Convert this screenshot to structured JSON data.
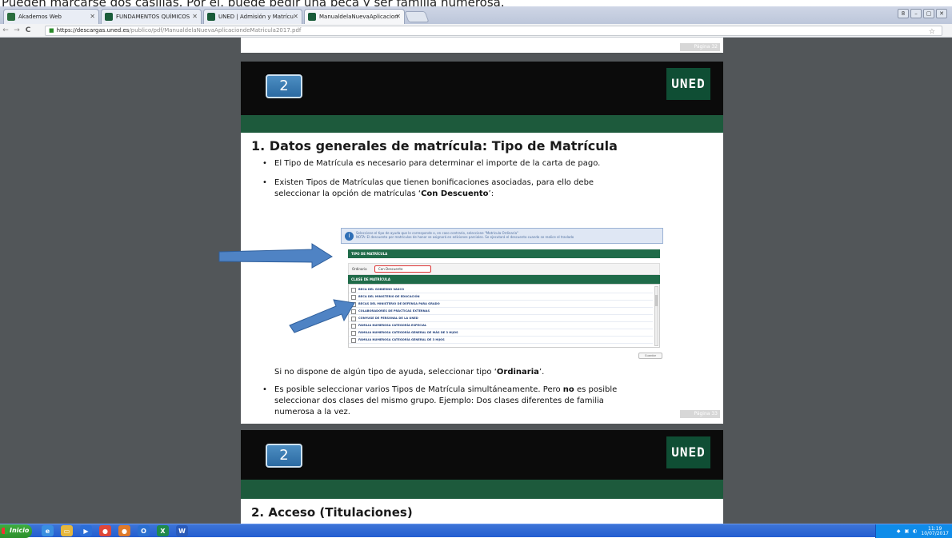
{
  "caption": {
    "text": "Pueden marcarse dos casillas. Por ej. puede pedir una beca y ser familia numerosa."
  },
  "browser": {
    "tabs": [
      {
        "title": "Akademos Web",
        "favicon_color": "#2b6e3f"
      },
      {
        "title": "FUNDAMENTOS QUÍMICOS",
        "favicon_color": "#1a5c3a"
      },
      {
        "title": "UNED | Admisión y Matrícu",
        "favicon_color": "#1a5c3a"
      },
      {
        "title": "ManualdelaNuevaAplicacion",
        "favicon_color": "#1a5c3a"
      }
    ],
    "active_tab": 3,
    "url_host": "https://descargas.uned.es",
    "url_path": "/publico/pdf/ManualdelaNuevaAplicaciondeMatricula2017.pdf",
    "nav": {
      "back": "←",
      "forward": "→",
      "reload": "C"
    },
    "window_buttons": [
      "8",
      "–",
      "▢",
      "✕"
    ]
  },
  "pdf": {
    "page_top_number": "Página 32",
    "slide1": {
      "number": "2",
      "logo": "UNED",
      "title": "1. Datos generales de matrícula: Tipo de Matrícula",
      "bullet1": "El Tipo de Matrícula es necesario para determinar el importe de la carta de pago.",
      "bullet2_line1": "Existen Tipos de Matrículas que tienen bonificaciones asociadas, para ello debe",
      "bullet2_line2_pre": "seleccionar la opción de matrículas  ‘",
      "bullet2_bold": "Con Descuento",
      "bullet2_post": "’:",
      "screenshot": {
        "info_line1": "Seleccione el tipo de ayuda que le corresponde o, en caso contrario, seleccione \"Matrícula Ordinaria\"",
        "info_line2": "NOTA: El descuento por matrículas de honor se asignará en ediciones parciales. Se ejecutará el descuento cuando se realice el traslado",
        "section1": "TIPO DE MATRÍCULA",
        "radio_ordinaria": "Ordinaria",
        "radio_descuento": "Con Descuento",
        "section2": "CLASE DE MATRÍCULA",
        "options": [
          "BECA DEL GOBIERNO VASCO",
          "BECA DEL MINISTERIO DE EDUCACIÓN",
          "BECAS DEL MINISTERIO DE DEFENSA PARA GRADO",
          "COLABORADORES DE PRÁCTICAS EXTERNAS",
          "CÓNYUGE DE PERSONAL DE LA UNED",
          "FAMILIA NUMEROSA CATEGORÍA ESPECIAL",
          "FAMILIA NUMEROSA CATEGORÍA GENERAL DE MÁS DE 3 HIJOS",
          "FAMILIA NUMEROSA CATEGORÍA GENERAL DE 3 HIJOS"
        ],
        "button": "Guardar"
      },
      "note_pre": "Si no dispone de algún tipo de ayuda, seleccionar tipo ‘",
      "note_bold": "Ordinaria",
      "note_post": "’.",
      "bullet3_line1_pre": "Es posible seleccionar varios Tipos de Matrícula simultáneamente. Pero ",
      "bullet3_bold": "no",
      "bullet3_line1_post": " es posible",
      "bullet3_line2": "seleccionar dos clases del mismo grupo. Ejemplo: Dos clases diferentes de familia",
      "bullet3_line3": "numerosa a la vez.",
      "page_number": "Página 33"
    },
    "slide2": {
      "number": "2",
      "logo": "UNED",
      "title": "2. Acceso (Titulaciones)"
    }
  },
  "taskbar": {
    "start_label": "Inicio",
    "apps": [
      {
        "name": "ie",
        "color": "#3a8fe0",
        "glyph": "e"
      },
      {
        "name": "folder",
        "color": "#e6b73c",
        "glyph": "▭"
      },
      {
        "name": "player",
        "color": "#2b6ed8",
        "glyph": "▶"
      },
      {
        "name": "chrome",
        "color": "#e0473a",
        "glyph": "●"
      },
      {
        "name": "firefox",
        "color": "#e07a2a",
        "glyph": "●"
      },
      {
        "name": "outlook",
        "color": "#2a6fd0",
        "glyph": "O"
      },
      {
        "name": "excel",
        "color": "#1f8a4c",
        "glyph": "X"
      },
      {
        "name": "word",
        "color": "#2a5ab8",
        "glyph": "W"
      }
    ],
    "time": "11:19",
    "date": "10/07/2017"
  },
  "colors": {
    "green_band": "#1d5a3c",
    "uned_logo": "#0f4e34",
    "arrow": "#4f83c4"
  }
}
